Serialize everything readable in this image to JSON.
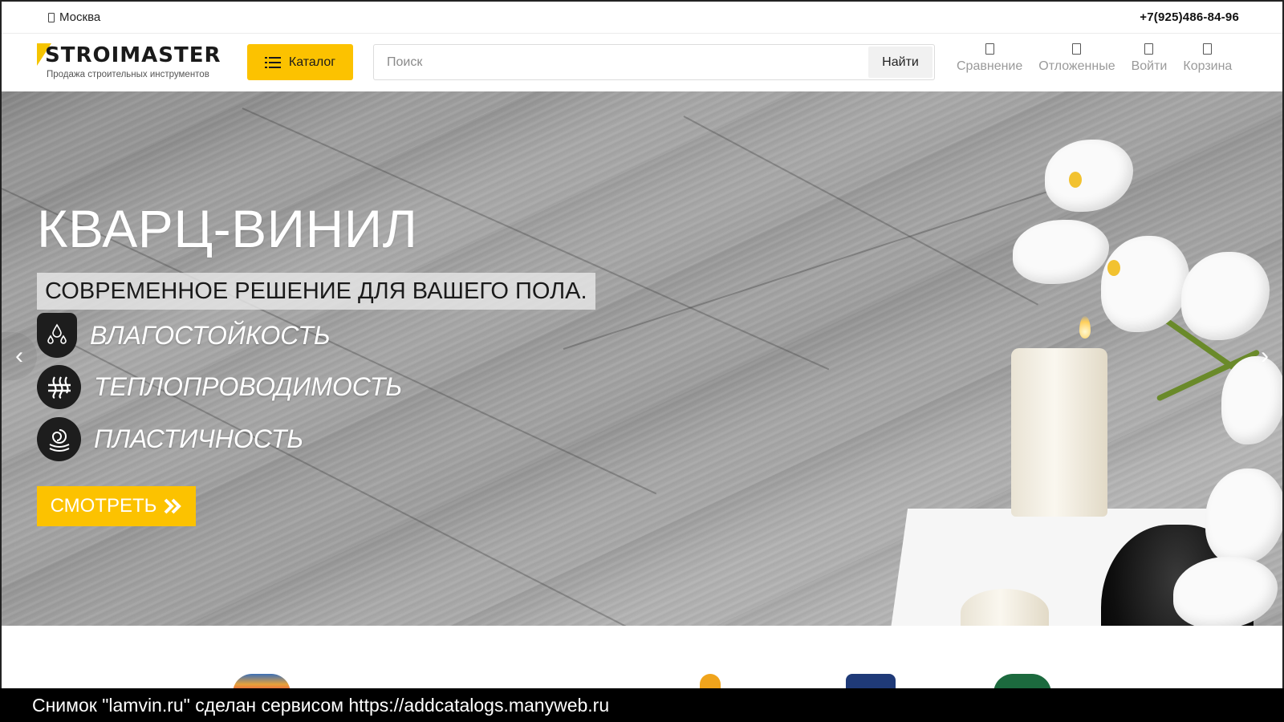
{
  "topbar": {
    "city": "Москва",
    "phone": "+7(925)486-84-96"
  },
  "logo": {
    "name": "STROIMASTER",
    "tagline": "Продажа строительных инструментов"
  },
  "catalog": {
    "label": "Каталог"
  },
  "search": {
    "placeholder": "Поиск",
    "button": "Найти"
  },
  "nav": [
    {
      "label": "Сравнение",
      "icon": "compare-icon"
    },
    {
      "label": "Отложенные",
      "icon": "heart-icon"
    },
    {
      "label": "Войти",
      "icon": "user-icon"
    },
    {
      "label": "Корзина",
      "icon": "cart-icon"
    }
  ],
  "hero": {
    "title": "КВАРЦ-ВИНИЛ",
    "subtitle": "СОВРЕМЕННОЕ РЕШЕНИЕ ДЛЯ ВАШЕГО ПОЛА.",
    "features": [
      {
        "label": "ВЛАГОСТОЙКОСТЬ",
        "icon": "water-drops-icon"
      },
      {
        "label": "ТЕПЛОПРОВОДИМОСТЬ",
        "icon": "heat-icon"
      },
      {
        "label": "ПЛАСТИЧНОСТЬ",
        "icon": "flexibility-icon"
      }
    ],
    "cta": "СМОТРЕТЬ"
  },
  "colors": {
    "accent": "#fcc200",
    "dark": "#1d1d1d"
  },
  "watermark": "Снимок \"lamvin.ru\" сделан сервисом https://addcatalogs.manyweb.ru"
}
